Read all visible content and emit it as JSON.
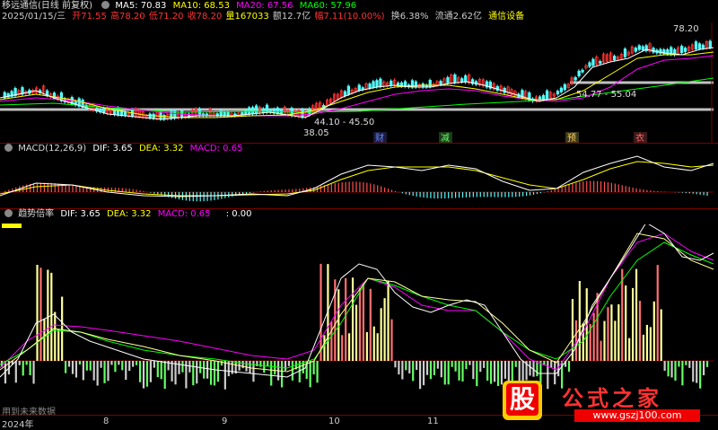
{
  "header": {
    "stock_title": "移远通信(日线 前复权)",
    "ma": [
      {
        "label": "MA5: 70.83",
        "color": "#ffffff"
      },
      {
        "label": "MA10: 68.53",
        "color": "#ffff00"
      },
      {
        "label": "MA20: 67.56",
        "color": "#ff00ff"
      },
      {
        "label": "MA60: 57.96",
        "color": "#00ff00"
      }
    ],
    "quote": {
      "date": "2025/01/15/三",
      "open": "开71.55",
      "high": "高78.20",
      "low": "低71.20",
      "close": "收78.20",
      "volume": "量167033",
      "amount": "额12.7亿",
      "change": "幅7.11(10.00%)",
      "turnover": "换6.38%",
      "float": "流通2.62亿",
      "sector": "通信设备"
    }
  },
  "price_pane": {
    "annotations": {
      "high_label": "78.20",
      "mid_label": "54.77 - 55.04",
      "low_range": "44.10 - 45.50",
      "low_label": "38.05"
    },
    "markers": [
      "财",
      "减",
      "预",
      "衣"
    ]
  },
  "macd_pane": {
    "title": "MACD(12,26,9)",
    "dif": "DIF: 3.65",
    "dea": "DEA: 3.32",
    "macd": "MACD: 0.65"
  },
  "custom_pane": {
    "title": "趋势倍率",
    "dif": "DIF: 3.65",
    "dea": "DEA: 3.32",
    "macd": "MACD: 0.65",
    "extra": ": 0.00"
  },
  "footer": {
    "watermark_left": "用到未来数据",
    "year": "2024年",
    "months": [
      "8",
      "9",
      "10",
      "11"
    ]
  },
  "logo": {
    "char": "股",
    "text": "公式之家",
    "url": "www.gszj100.com"
  },
  "colors": {
    "up": "#ff3232",
    "down": "#54fcfc",
    "ma5": "#ffffff",
    "ma10": "#ffff00",
    "ma20": "#ff00ff",
    "ma60": "#00ff00"
  }
}
